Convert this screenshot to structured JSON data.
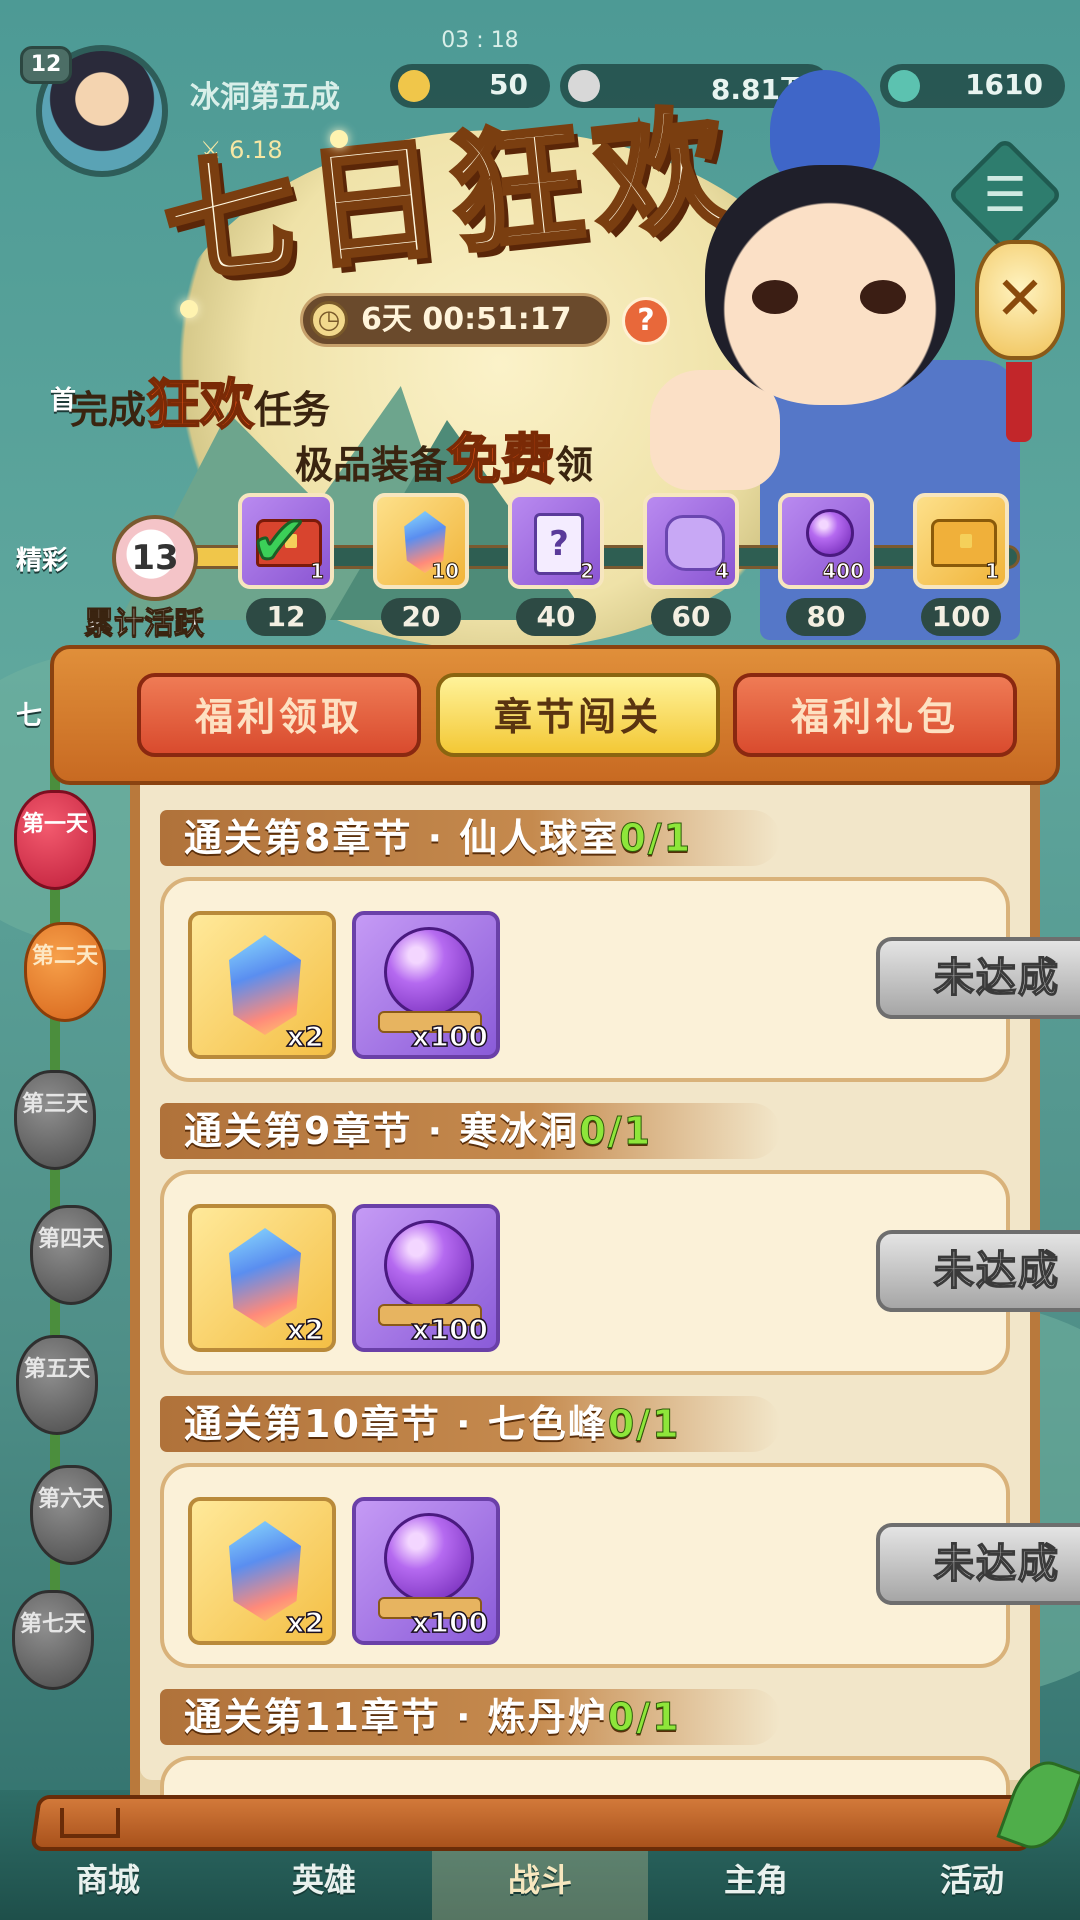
{
  "status_bar": {
    "clock": "03 : 18"
  },
  "player": {
    "level": "12",
    "name": "冰洞第五成",
    "power": "6.18",
    "resources": [
      {
        "icon": "gold-coin-icon",
        "value": "50"
      },
      {
        "icon": "silver-icon",
        "value": "8.81万"
      },
      {
        "icon": "gem-icon",
        "value": "1610"
      }
    ]
  },
  "event": {
    "title": "七日狂欢",
    "timer": "6天 00:51:17",
    "help": "?",
    "slogan_line1": {
      "pre": "完成",
      "highlight": "狂欢",
      "post": "任务"
    },
    "slogan_line2": {
      "pre": "极品装备",
      "highlight": "免费",
      "post": "领"
    },
    "activity": {
      "label": "累计活跃",
      "current": "13",
      "milestones": [
        {
          "threshold": "12",
          "reward_icon": "red-chest-icon",
          "count": "1",
          "claimed": true
        },
        {
          "threshold": "20",
          "reward_icon": "crystal-icon",
          "count": "10",
          "claimed": false
        },
        {
          "threshold": "40",
          "reward_icon": "mystery-card-icon",
          "count": "2",
          "claimed": false
        },
        {
          "threshold": "60",
          "reward_icon": "purple-ore-icon",
          "count": "4",
          "claimed": false
        },
        {
          "threshold": "80",
          "reward_icon": "purple-orb-icon",
          "count": "400",
          "claimed": false
        },
        {
          "threshold": "100",
          "reward_icon": "gold-chest-icon",
          "count": "1",
          "claimed": false
        }
      ]
    }
  },
  "side_days": [
    "第一天",
    "第二天",
    "第三天",
    "第四天",
    "第五天",
    "第六天",
    "第七天"
  ],
  "side_labels": {
    "a": "首",
    "b": "精彩",
    "c": "七"
  },
  "tabs": [
    {
      "label": "福利领取",
      "active": false
    },
    {
      "label": "章节闯关",
      "active": true
    },
    {
      "label": "福利礼包",
      "active": false
    }
  ],
  "quests": [
    {
      "title": "通关第8章节 · 仙人球室",
      "progress": "0/1",
      "rewards": [
        {
          "icon": "crystal-icon",
          "qty": "x2"
        },
        {
          "icon": "purple-orb-icon",
          "qty": "x100"
        }
      ],
      "status": "未达成"
    },
    {
      "title": "通关第9章节 · 寒冰洞",
      "progress": "0/1",
      "rewards": [
        {
          "icon": "crystal-icon",
          "qty": "x2"
        },
        {
          "icon": "purple-orb-icon",
          "qty": "x100"
        }
      ],
      "status": "未达成"
    },
    {
      "title": "通关第10章节 · 七色峰",
      "progress": "0/1",
      "rewards": [
        {
          "icon": "crystal-icon",
          "qty": "x2"
        },
        {
          "icon": "purple-orb-icon",
          "qty": "x100"
        }
      ],
      "status": "未达成"
    },
    {
      "title": "通关第11章节 · 炼丹炉",
      "progress": "0/1"
    }
  ],
  "bottom_nav": [
    "商城",
    "英雄",
    "战斗",
    "主角",
    "活动"
  ],
  "colors": {
    "tab_active": "#f3c835",
    "tab_inactive": "#d94b2e",
    "progress_text": "#8ee63a",
    "status_button": "#a6a6a6"
  }
}
